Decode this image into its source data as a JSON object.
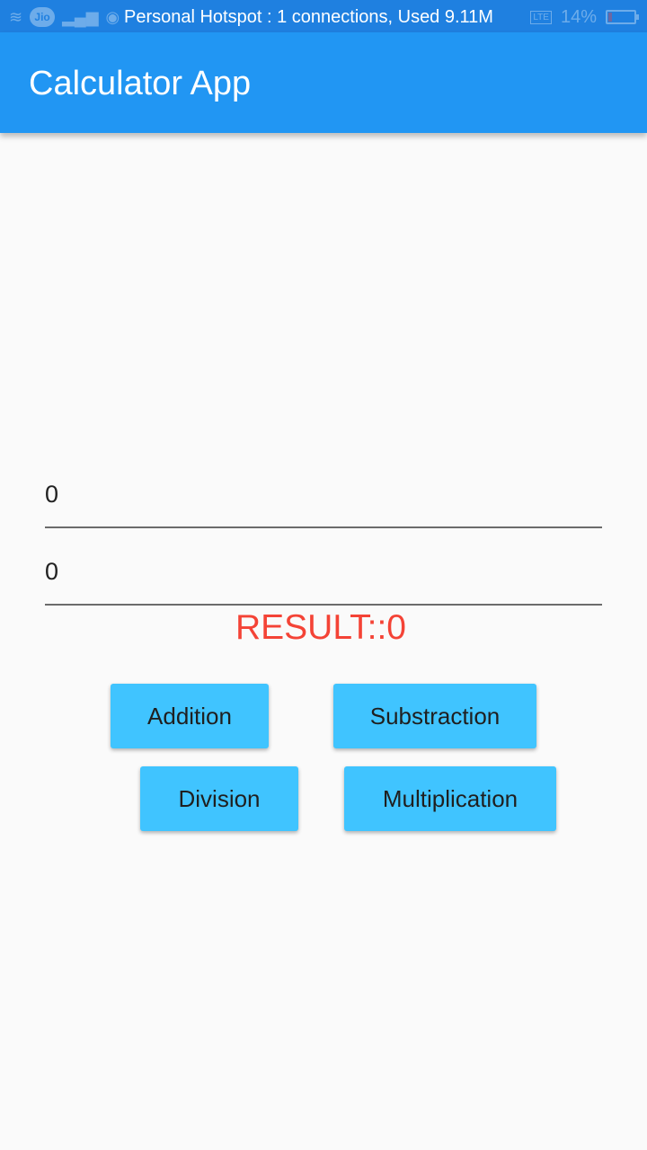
{
  "status_bar": {
    "carrier": "Jio",
    "notification": "Personal Hotspot : 1 connections, Used 9.11M",
    "network_badge": "LTE",
    "battery_percent": "14%",
    "battery_level": 0.14,
    "icons": [
      "wifi-icon",
      "signal-icon",
      "vodafone-icon",
      "battery-icon"
    ]
  },
  "app_bar": {
    "title": "Calculator App",
    "color": "#2196f3"
  },
  "inputs": {
    "first_value": "0",
    "second_value": "0"
  },
  "result": {
    "text": "RESULT::0",
    "color": "#f44336"
  },
  "buttons": {
    "addition": "Addition",
    "subtraction": "Substraction",
    "division": "Division",
    "multiplication": "Multiplication",
    "color": "#40c4ff"
  }
}
